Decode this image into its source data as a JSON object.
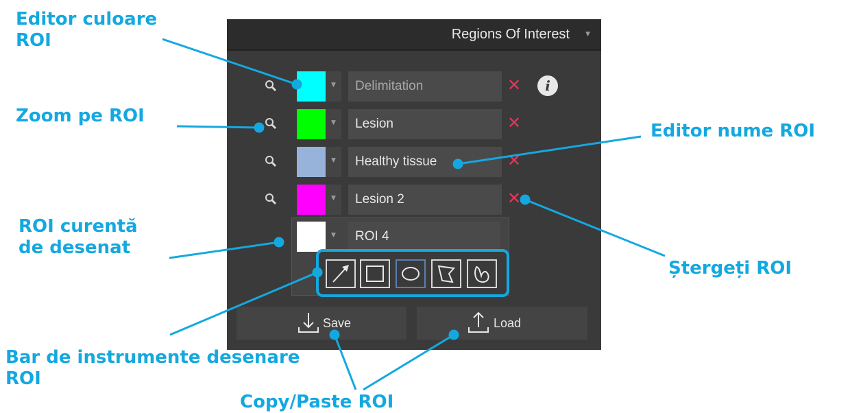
{
  "panel": {
    "title": "Regions Of Interest",
    "rois": [
      {
        "name": "Delimitation",
        "color": "#00ffff"
      },
      {
        "name": "Lesion",
        "color": "#00ff00"
      },
      {
        "name": "Healthy tissue",
        "color": "#97b3d9"
      },
      {
        "name": "Lesion 2",
        "color": "#ff00ff"
      }
    ],
    "current_roi": {
      "name": "ROI 4",
      "color": "#ffffff"
    },
    "tools": [
      "arrow",
      "rectangle",
      "ellipse",
      "polygon",
      "freehand"
    ],
    "save_label": "Save",
    "load_label": "Load",
    "info_glyph": "i",
    "delete_glyph": "✕"
  },
  "callouts": {
    "color_editor": [
      "Editor culoare",
      "ROI"
    ],
    "zoom": "Zoom pe ROI",
    "name_editor": "Editor nume ROI",
    "current": [
      "ROI curentă",
      "de desenat"
    ],
    "delete": "Ștergeți ROI",
    "toolbar": [
      "Bar de instrumente desenare",
      "ROI"
    ],
    "copy_paste": "Copy/Paste ROI"
  },
  "colors": {
    "accent": "#14a8e0",
    "delete": "#e8355a",
    "panel_bg": "#3a3a3a"
  }
}
